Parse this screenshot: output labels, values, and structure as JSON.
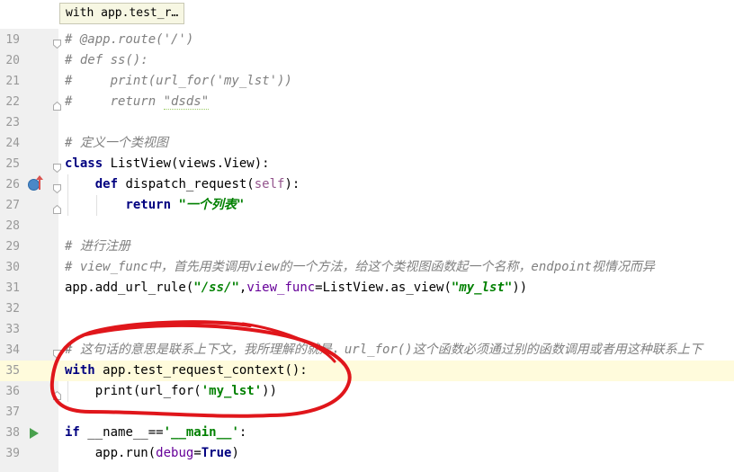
{
  "breadcrumb": "with app.test_r…",
  "lines": [
    {
      "n": "19",
      "segments": [
        {
          "t": "# @app.route('/')",
          "c": "c-comment"
        }
      ]
    },
    {
      "n": "20",
      "segments": [
        {
          "t": "# def ss():",
          "c": "c-comment"
        }
      ]
    },
    {
      "n": "21",
      "segments": [
        {
          "t": "#     print(url_for('my_lst'))",
          "c": "c-comment"
        }
      ]
    },
    {
      "n": "22",
      "segments": [
        {
          "t": "#     return ",
          "c": "c-comment"
        },
        {
          "t": "\"dsds\"",
          "c": "c-comment underline-weak"
        }
      ]
    },
    {
      "n": "23",
      "segments": []
    },
    {
      "n": "24",
      "segments": [
        {
          "t": "# 定义一个类视图",
          "c": "c-comment"
        }
      ]
    },
    {
      "n": "25",
      "segments": [
        {
          "t": "class ",
          "c": "c-kw"
        },
        {
          "t": "ListView(views.View):",
          "c": ""
        }
      ]
    },
    {
      "n": "26",
      "segments": [
        {
          "t": "    ",
          "c": ""
        },
        {
          "t": "def ",
          "c": "c-kw"
        },
        {
          "t": "dispatch_request(",
          "c": ""
        },
        {
          "t": "self",
          "c": "c-self"
        },
        {
          "t": "):",
          "c": ""
        }
      ]
    },
    {
      "n": "27",
      "segments": [
        {
          "t": "        ",
          "c": ""
        },
        {
          "t": "return ",
          "c": "c-kw"
        },
        {
          "t": "\"一个列表\"",
          "c": "c-str"
        }
      ]
    },
    {
      "n": "28",
      "segments": []
    },
    {
      "n": "29",
      "segments": [
        {
          "t": "# 进行注册",
          "c": "c-comment"
        }
      ]
    },
    {
      "n": "30",
      "segments": [
        {
          "t": "# view_func中，首先用类调用view的一个方法，给这个类视图函数起一个名称，endpoint视情况而异",
          "c": "c-comment"
        }
      ]
    },
    {
      "n": "31",
      "segments": [
        {
          "t": "app.add_url_rule(",
          "c": ""
        },
        {
          "t": "\"/ss/\"",
          "c": "c-str"
        },
        {
          "t": ",",
          "c": ""
        },
        {
          "t": "view_func",
          "c": "c-param"
        },
        {
          "t": "=ListView.as_view(",
          "c": ""
        },
        {
          "t": "\"my_lst\"",
          "c": "c-str"
        },
        {
          "t": "))",
          "c": ""
        }
      ]
    },
    {
      "n": "32",
      "segments": []
    },
    {
      "n": "33",
      "segments": []
    },
    {
      "n": "34",
      "segments": [
        {
          "t": "# 这句话的意思是联系上下文，我所理解的就是，url_for()这个函数必须通过别的函数调用或者用这种联系上下",
          "c": "c-comment"
        }
      ]
    },
    {
      "n": "35",
      "segments": [
        {
          "t": "with ",
          "c": "c-kw"
        },
        {
          "t": "app.test_request_context():",
          "c": ""
        }
      ],
      "current": true
    },
    {
      "n": "36",
      "segments": [
        {
          "t": "    print(url_for(",
          "c": ""
        },
        {
          "t": "'my_lst'",
          "c": "c-str2"
        },
        {
          "t": "))",
          "c": ""
        }
      ]
    },
    {
      "n": "37",
      "segments": []
    },
    {
      "n": "38",
      "segments": [
        {
          "t": "if ",
          "c": "c-kw"
        },
        {
          "t": "__name__==",
          "c": ""
        },
        {
          "t": "'__main__'",
          "c": "c-str2"
        },
        {
          "t": ":",
          "c": ""
        }
      ]
    },
    {
      "n": "39",
      "segments": [
        {
          "t": "    app.run(",
          "c": ""
        },
        {
          "t": "debug",
          "c": "c-param"
        },
        {
          "t": "=",
          "c": ""
        },
        {
          "t": "True",
          "c": "c-kw"
        },
        {
          "t": ")",
          "c": ""
        }
      ]
    }
  ],
  "gutter_icons": {
    "override_line": "26",
    "run_line": "38"
  },
  "colors": {
    "keyword": "#000080",
    "string": "#008000",
    "comment": "#808080",
    "annotation": "#e0161b",
    "current_line": "#fffbdc"
  }
}
